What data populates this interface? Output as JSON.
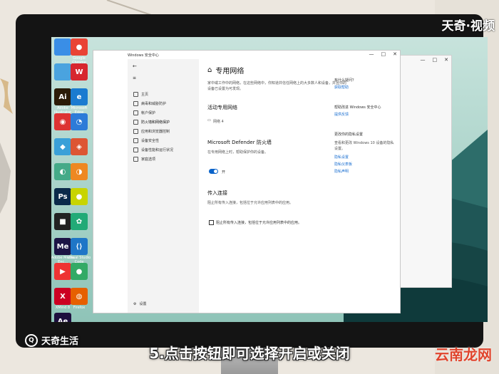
{
  "overlays": {
    "watermark_top": "天奇·视频",
    "logo_bottom": "天奇生活",
    "logo_mark": "Q",
    "caption": "5.点击按钮即可选择开启或关闭",
    "site_logo": "云南龙网"
  },
  "desktop_icons": [
    {
      "label": "",
      "glyph": "",
      "color": "#3a8ee6",
      "icon": "computer-icon"
    },
    {
      "label": "Google Chrome",
      "glyph": "●",
      "color": "#e94335",
      "icon": "chrome-icon"
    },
    {
      "label": "",
      "glyph": "",
      "color": "#4aa3df",
      "icon": "folder-icon"
    },
    {
      "label": "",
      "glyph": "W",
      "color": "#d7272e",
      "icon": "wps-icon"
    },
    {
      "label": "Adobe Illustrator",
      "glyph": "Ai",
      "color": "#2b1b07",
      "icon": "illustrator-icon"
    },
    {
      "label": "Microsoft Edge",
      "glyph": "e",
      "color": "#1a7bd0",
      "icon": "edge-icon"
    },
    {
      "label": "",
      "glyph": "◉",
      "color": "#d33",
      "icon": "app-icon"
    },
    {
      "label": "",
      "glyph": "◔",
      "color": "#2d7bd8",
      "icon": "app-icon"
    },
    {
      "label": "",
      "glyph": "◆",
      "color": "#3aa0d8",
      "icon": "app-icon"
    },
    {
      "label": "",
      "glyph": "◈",
      "color": "#d53",
      "icon": "app-icon"
    },
    {
      "label": "",
      "glyph": "◐",
      "color": "#4a8",
      "icon": "app-icon"
    },
    {
      "label": "",
      "glyph": "◑",
      "color": "#e82",
      "icon": "app-icon"
    },
    {
      "label": "",
      "glyph": "Ps",
      "color": "#0b2a4a",
      "icon": "photoshop-icon"
    },
    {
      "label": "",
      "glyph": "●",
      "color": "#c8d400",
      "icon": "app-icon"
    },
    {
      "label": "",
      "glyph": "■",
      "color": "#222",
      "icon": "app-icon"
    },
    {
      "label": "",
      "glyph": "✿",
      "color": "#2a7",
      "icon": "app-icon"
    },
    {
      "label": "Adobe Media Enc...",
      "glyph": "Me",
      "color": "#1c1445",
      "icon": "media-encoder-icon"
    },
    {
      "label": "Visual Studio Code",
      "glyph": "⟨⟩",
      "color": "#1f76c7",
      "icon": "vscode-icon"
    },
    {
      "label": "",
      "glyph": "▶",
      "color": "#e33",
      "icon": "app-icon"
    },
    {
      "label": "",
      "glyph": "●",
      "color": "#3a6",
      "icon": "app-icon"
    },
    {
      "label": "XMind 8",
      "glyph": "X",
      "color": "#c02",
      "icon": "xmind-icon"
    },
    {
      "label": "Firefox",
      "glyph": "◍",
      "color": "#e66000",
      "icon": "firefox-icon"
    },
    {
      "label": "Adobe After Effects",
      "glyph": "Ae",
      "color": "#1d0f3e",
      "icon": "aftereffects-icon"
    }
  ],
  "back_window": {
    "controls": [
      "—",
      "□",
      "✕"
    ]
  },
  "main_window": {
    "title": "Windows 安全中心",
    "controls": [
      "—",
      "□",
      "✕"
    ],
    "back_arrow": "←",
    "hamburger": "≡",
    "nav": [
      {
        "label": "主页",
        "active": false
      },
      {
        "label": "病毒和威胁防护",
        "active": false
      },
      {
        "label": "帐户保护",
        "active": false
      },
      {
        "label": "防火墙和网络保护",
        "active": true
      },
      {
        "label": "应用和浏览器控制",
        "active": false
      },
      {
        "label": "设备安全性",
        "active": false
      },
      {
        "label": "设备性能和运行状况",
        "active": false
      },
      {
        "label": "家庭选项",
        "active": false
      }
    ],
    "settings_label": "设置",
    "settings_icon": "⚙",
    "content": {
      "heading_icon": "⌂",
      "heading": "专用网络",
      "desc_line1": "家中或工作中的网络，在这些网络中，你知道并信任网络上的大多数人和设备，并且你的",
      "desc_line2": "设备已设置为可发现。",
      "active_networks_heading": "活动专用网络",
      "network_name": "网络 4",
      "firewall_heading": "Microsoft Defender 防火墙",
      "firewall_desc": "在专用网络上时，帮助保护你的设备。",
      "toggle_state": "开",
      "incoming_heading": "传入连接",
      "incoming_desc": "阻止所有传入连接，包括位于允许应用列表中的应用。",
      "checkbox_label": "阻止所有传入连接，包括位于允许应用列表中的应用。"
    },
    "right_column": {
      "q1": "有什么疑问？",
      "q1_link": "获取帮助",
      "q2": "帮助改进 Windows 安全中心",
      "q2_link": "提供反馈",
      "q3": "更改你的隐私设置",
      "q3_desc_line1": "查看和更改 Windows 10 设备的隐私",
      "q3_desc_line2": "设置。",
      "q3_link1": "隐私设置",
      "q3_link2": "隐私仪表板",
      "q3_link3": "隐私声明"
    }
  }
}
